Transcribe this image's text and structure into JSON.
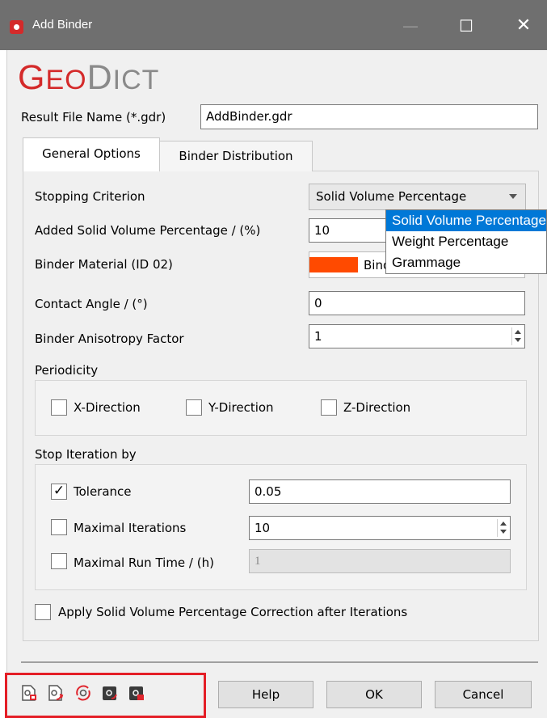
{
  "window": {
    "title": "Add Binder",
    "minimize_symbol": "—",
    "maximize_symbol": "☐",
    "close_symbol": "✕"
  },
  "logo": {
    "part1_big": "G",
    "part1_small": "EO",
    "part2_big": "D",
    "part2_small": "ICT"
  },
  "result_file": {
    "label": "Result File Name (*.gdr)",
    "value": "AddBinder.gdr"
  },
  "tabs": [
    {
      "label": "General Options",
      "active": true
    },
    {
      "label": "Binder Distribution",
      "active": false
    }
  ],
  "general": {
    "stopping_criterion": {
      "label": "Stopping Criterion",
      "value": "Solid Volume Percentage"
    },
    "added_solid_volume": {
      "label": "Added Solid Volume Percentage / (%)",
      "value": "10"
    },
    "binder_material": {
      "label": "Binder Material (ID 02)",
      "value": "Binder",
      "color": "#ff4a00"
    },
    "contact_angle": {
      "label": "Contact Angle / (°)",
      "value": "0"
    },
    "anisotropy": {
      "label": "Binder Anisotropy Factor",
      "value": "1"
    },
    "periodicity": {
      "label": "Periodicity",
      "x": {
        "label": "X-Direction",
        "checked": false
      },
      "y": {
        "label": "Y-Direction",
        "checked": false
      },
      "z": {
        "label": "Z-Direction",
        "checked": false
      }
    },
    "stop_iteration": {
      "label": "Stop Iteration by",
      "tolerance": {
        "label": "Tolerance",
        "checked": true,
        "check_glyph": "✓",
        "value": "0.05"
      },
      "max_iterations": {
        "label": "Maximal Iterations",
        "checked": false,
        "value": "10"
      },
      "max_runtime": {
        "label": "Maximal Run Time / (h)",
        "checked": false,
        "value": "1"
      }
    },
    "correction": {
      "label": "Apply Solid Volume Percentage Correction after Iterations",
      "checked": false
    }
  },
  "dropdown_options": [
    "Solid Volume Percentage",
    "Weight Percentage",
    "Grammage"
  ],
  "dropdown_selected_index": 0,
  "toolbar_icons": [
    "load-settings-icon",
    "save-settings-icon",
    "reset-settings-icon",
    "export-macro-icon",
    "record-macro-icon"
  ],
  "buttons": {
    "help": "Help",
    "ok": "OK",
    "cancel": "Cancel"
  },
  "colors": {
    "titlebar": "#6f6f6f",
    "brand_red": "#d42a2a",
    "selection_blue": "#0078d7",
    "highlight_red": "#e41e26"
  }
}
